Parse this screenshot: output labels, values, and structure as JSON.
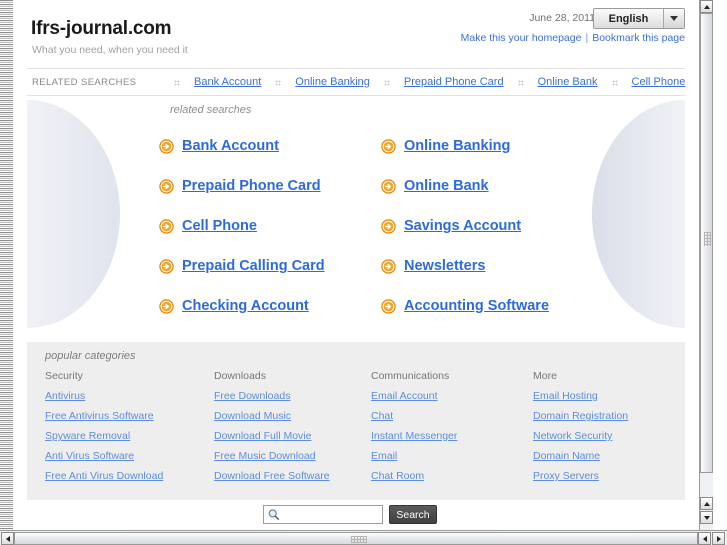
{
  "header": {
    "site_title": "Ifrs-journal.com",
    "tagline": "What you need, when you need it",
    "date": "June 28, 2011",
    "language_selected": "English",
    "links": [
      {
        "label": "Make this your homepage"
      },
      {
        "label": "Bookmark this page"
      }
    ],
    "link_separator": "|"
  },
  "related_searches_bar": {
    "label": "RELATED SEARCHES",
    "items": [
      {
        "label": "Bank Account"
      },
      {
        "label": "Online Banking"
      },
      {
        "label": "Prepaid Phone Card"
      },
      {
        "label": "Online Bank"
      },
      {
        "label": "Cell Phone"
      }
    ]
  },
  "main": {
    "caption": "related searches",
    "items": [
      {
        "label": "Bank Account",
        "icon": "arrow-circle-right-icon"
      },
      {
        "label": "Online Banking",
        "icon": "arrow-circle-right-icon"
      },
      {
        "label": "Prepaid Phone Card",
        "icon": "arrow-circle-right-icon"
      },
      {
        "label": "Online Bank",
        "icon": "arrow-circle-right-icon"
      },
      {
        "label": "Cell Phone",
        "icon": "arrow-circle-right-icon"
      },
      {
        "label": "Savings Account",
        "icon": "arrow-circle-right-icon"
      },
      {
        "label": "Prepaid Calling Card",
        "icon": "arrow-circle-right-icon"
      },
      {
        "label": "Newsletters",
        "icon": "arrow-circle-right-icon"
      },
      {
        "label": "Checking Account",
        "icon": "arrow-circle-right-icon"
      },
      {
        "label": "Accounting Software",
        "icon": "arrow-circle-right-icon"
      }
    ]
  },
  "popular_categories": {
    "caption": "popular categories",
    "columns": [
      {
        "heading": "Security",
        "links": [
          {
            "label": "Antivirus"
          },
          {
            "label": "Free Antivirus Software"
          },
          {
            "label": "Spyware Removal"
          },
          {
            "label": "Anti Virus Software"
          },
          {
            "label": "Free Anti Virus Download"
          }
        ]
      },
      {
        "heading": "Downloads",
        "links": [
          {
            "label": "Free Downloads"
          },
          {
            "label": "Download Music"
          },
          {
            "label": "Download Full Movie"
          },
          {
            "label": "Free Music Download"
          },
          {
            "label": "Download Free Software"
          }
        ]
      },
      {
        "heading": "Communications",
        "links": [
          {
            "label": "Email Account"
          },
          {
            "label": "Chat"
          },
          {
            "label": "Instant Messenger"
          },
          {
            "label": "Email"
          },
          {
            "label": "Chat Room"
          }
        ]
      },
      {
        "heading": "More",
        "links": [
          {
            "label": "Email Hosting"
          },
          {
            "label": "Domain Registration"
          },
          {
            "label": "Network Security"
          },
          {
            "label": "Domain Name"
          },
          {
            "label": "Proxy Servers"
          }
        ]
      }
    ]
  },
  "search": {
    "value": "",
    "placeholder": "",
    "button_label": "Search",
    "icon": "magnifier-icon"
  },
  "colors": {
    "link_blue": "#3a6fd8",
    "main_link_blue": "#2b6ae0",
    "category_link_blue": "#5b8de0",
    "arrow_orange": "#f08a00",
    "panel_grey": "#eeeeee",
    "search_button_dark": "#404040"
  }
}
